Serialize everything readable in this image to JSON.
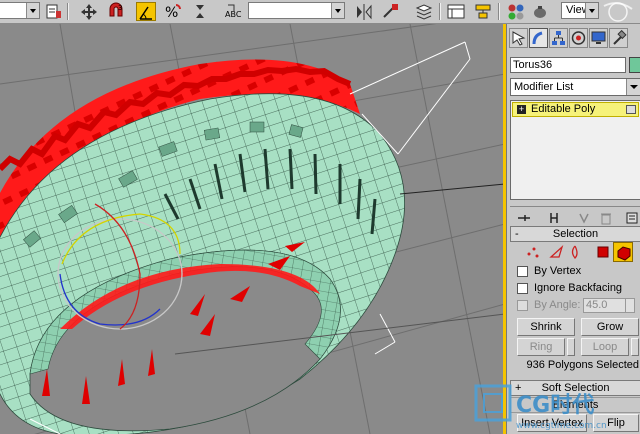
{
  "toolbar": {
    "view_dropdown": "View",
    "selection_filter_value": ""
  },
  "panel": {
    "object_name": "Torus36",
    "object_color": "#6fc79a",
    "modifier_list_label": "Modifier List",
    "stack_items": [
      {
        "label": "Editable Poly",
        "expand_sign": "+"
      }
    ],
    "selection": {
      "title": "Selection",
      "collapse_sign": "-",
      "by_vertex": "By Vertex",
      "ignore_backfacing": "Ignore Backfacing",
      "by_angle": "By Angle:",
      "by_angle_value": "45.0",
      "shrink": "Shrink",
      "grow": "Grow",
      "ring": "Ring",
      "loop": "Loop",
      "status": "936 Polygons Selected"
    },
    "soft_selection": {
      "title": "Soft Selection",
      "expand_sign": "+"
    },
    "edit_polygons_partial": "Insert Vertex",
    "flip_partial": "Flip",
    "elements_partial": "Elements"
  },
  "watermark": {
    "text": "CG时代",
    "url": "www.cgtime.com.cn"
  },
  "colors": {
    "accent_yellow": "#f5c400",
    "torus_green": "#a8e0c4",
    "selected_red": "#ff1a1a"
  }
}
